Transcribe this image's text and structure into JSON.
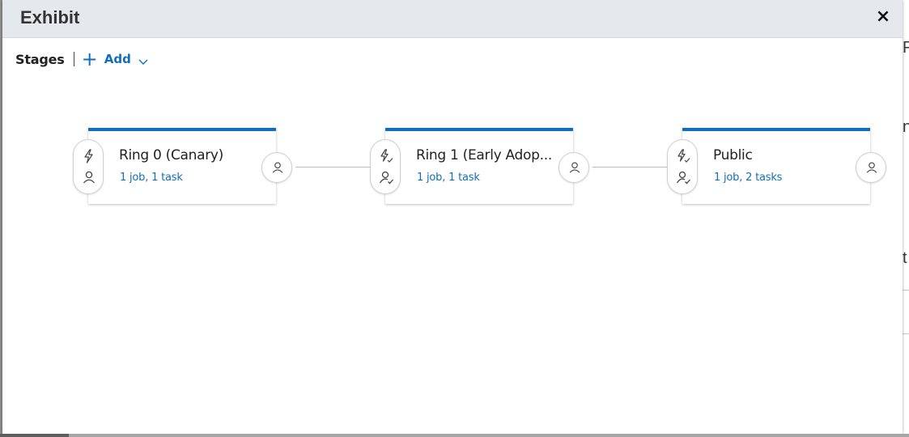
{
  "dialog": {
    "title": "Exhibit",
    "close_label": "×"
  },
  "toolbar": {
    "stages_label": "Stages",
    "add_label": "Add"
  },
  "stages": [
    {
      "name": "Ring 0 (Canary)",
      "meta": "1 job, 1 task",
      "pre_icon": "lightning-person-icon"
    },
    {
      "name": "Ring 1 (Early Adop...",
      "meta": "1 job, 1 task",
      "pre_icon": "lightning-person-check-icon"
    },
    {
      "name": "Public",
      "meta": "1 job, 2 tasks",
      "pre_icon": "lightning-person-check-icon"
    }
  ],
  "colors": {
    "accent": "#106ebe",
    "header_bg": "#e5e9ed",
    "connector": "#bdbdbd"
  },
  "background_fragments": [
    "P",
    "n",
    "t"
  ]
}
